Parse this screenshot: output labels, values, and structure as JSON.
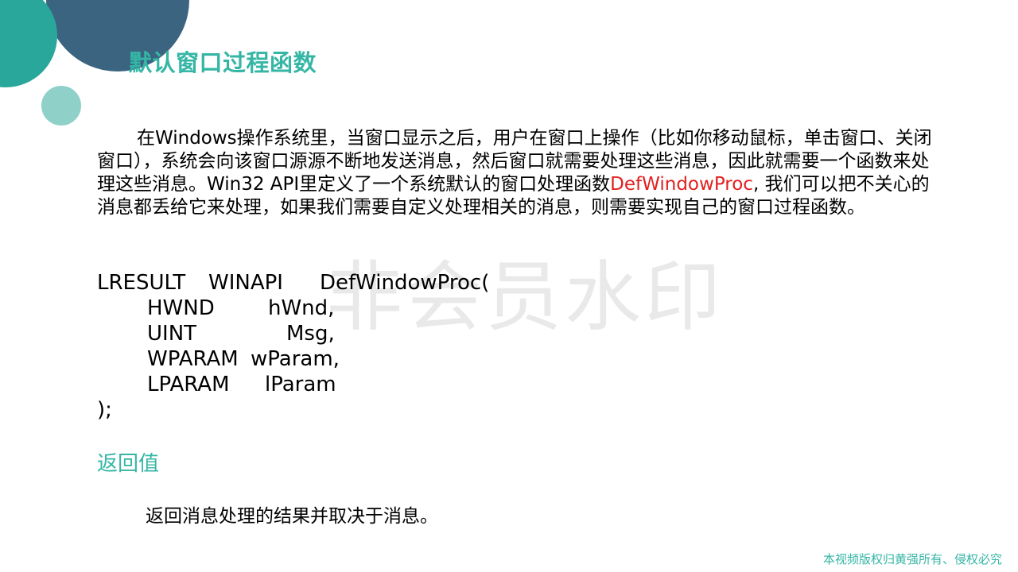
{
  "slide": {
    "title": "默认窗口过程函数",
    "paragraph": {
      "part1": "在Windows操作系统里，当窗口显示之后，用户在窗口上操作（比如你移动鼠标，单击窗口、关闭窗口），系统会向该窗口源源不断地发送消息，然后窗口就需要处理这些消息，因此就需要一个函数来处理这些消息。Win32 API里定义了一个系统默认的窗口处理函数",
      "highlight": "DefWindowProc",
      "part2": ", 我们可以把不关心的消息都丢给它来处理，如果我们需要自定义处理相关的消息，则需要实现自己的窗口过程函数。"
    },
    "code": {
      "line1": {
        "type": "LRESULT",
        "conv": "WINAPI",
        "name": "DefWindowProc("
      },
      "params": [
        {
          "type": "HWND",
          "name": "hWnd,"
        },
        {
          "type": "UINT",
          "name": "Msg,"
        },
        {
          "type": "WPARAM",
          "name": "wParam,"
        },
        {
          "type": "LPARAM",
          "name": "lParam"
        }
      ],
      "close": ");"
    },
    "return_heading": "返回值",
    "return_text": "返回消息处理的结果并取决于消息。",
    "watermark": "非会员水印",
    "footer": "本视频版权归黄强所有、侵权必究"
  },
  "colors": {
    "accent": "#35b6a5",
    "highlight": "#e21f1f",
    "deco_dark": "#3a6480",
    "deco_teal": "#2aa79b",
    "deco_light": "#8fd0c8"
  }
}
